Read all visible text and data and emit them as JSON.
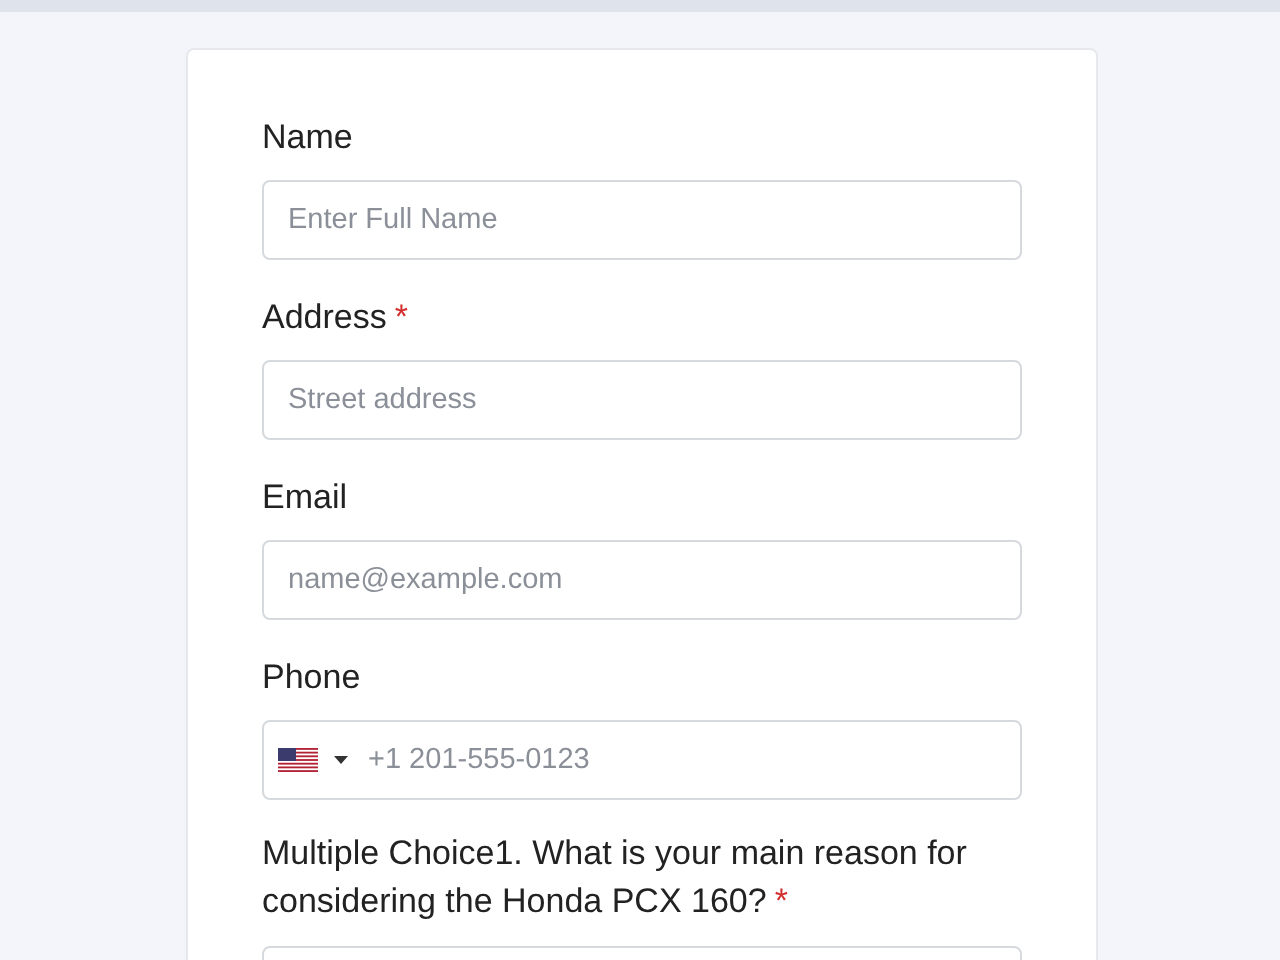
{
  "fields": [
    {
      "kind": "text",
      "label": "Name",
      "placeholder": "Enter Full Name"
    },
    {
      "kind": "text",
      "label": "Address",
      "required_mark": "*",
      "placeholder": "Street address"
    },
    {
      "kind": "text",
      "label": "Email",
      "placeholder": "name@example.com"
    },
    {
      "kind": "phone",
      "label": "Phone",
      "placeholder": "+1 201-555-0123"
    },
    {
      "kind": "choice",
      "label": "Multiple Choice1. What is your main reason for considering the Honda PCX 160?",
      "required_mark": "*"
    }
  ]
}
